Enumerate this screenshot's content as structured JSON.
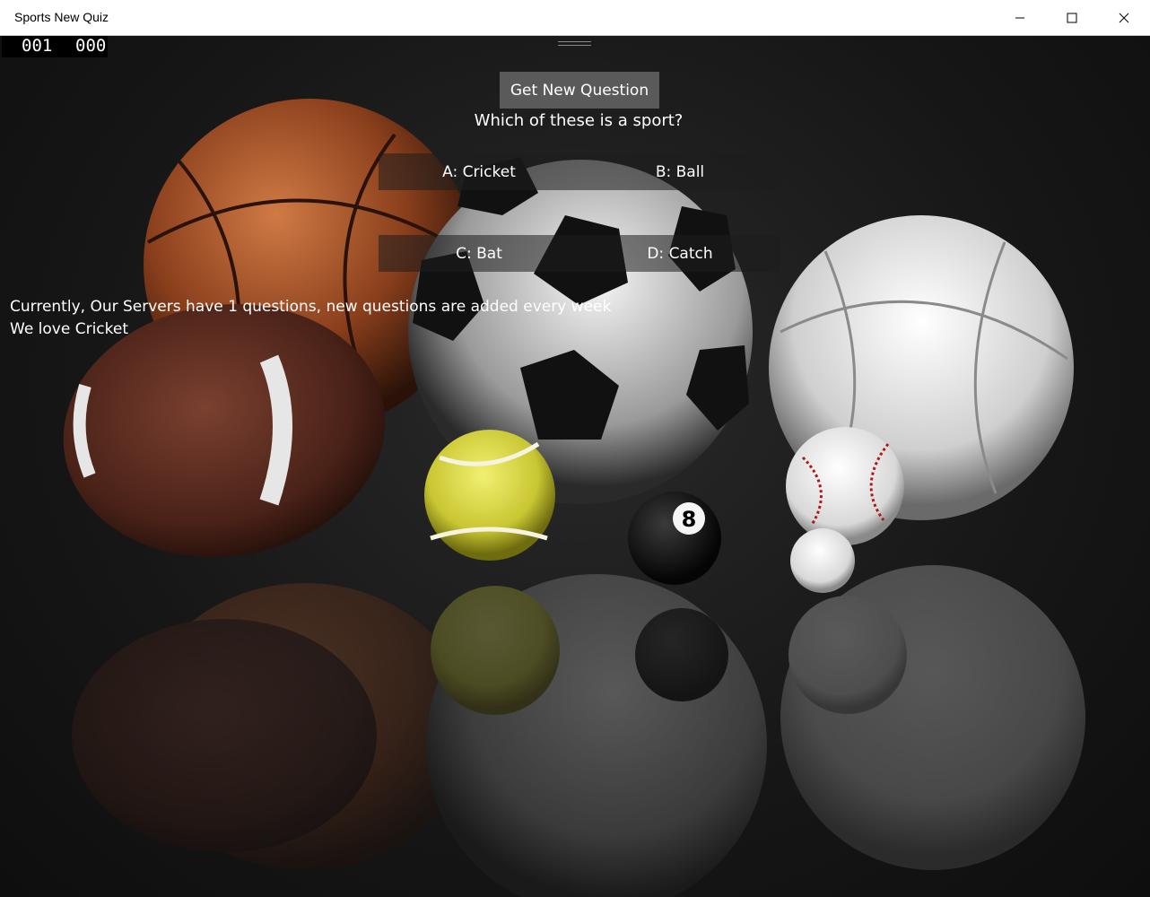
{
  "window": {
    "title": "Sports New Quiz"
  },
  "scoreboard": {
    "score_a": "001",
    "score_b": "000"
  },
  "quiz": {
    "new_question_label": "Get New Question",
    "question": "Which of these is a sport?",
    "answers": [
      {
        "label": "A: Cricket"
      },
      {
        "label": "B: Ball"
      },
      {
        "label": "C: Bat"
      },
      {
        "label": "D: Catch"
      }
    ]
  },
  "info": {
    "line1": "Currently, Our Servers have 1 questions, new questions are added every week",
    "line2": "We love Cricket"
  },
  "icons": {
    "minimize": "minimize-icon",
    "maximize": "maximize-icon",
    "close": "close-icon"
  }
}
